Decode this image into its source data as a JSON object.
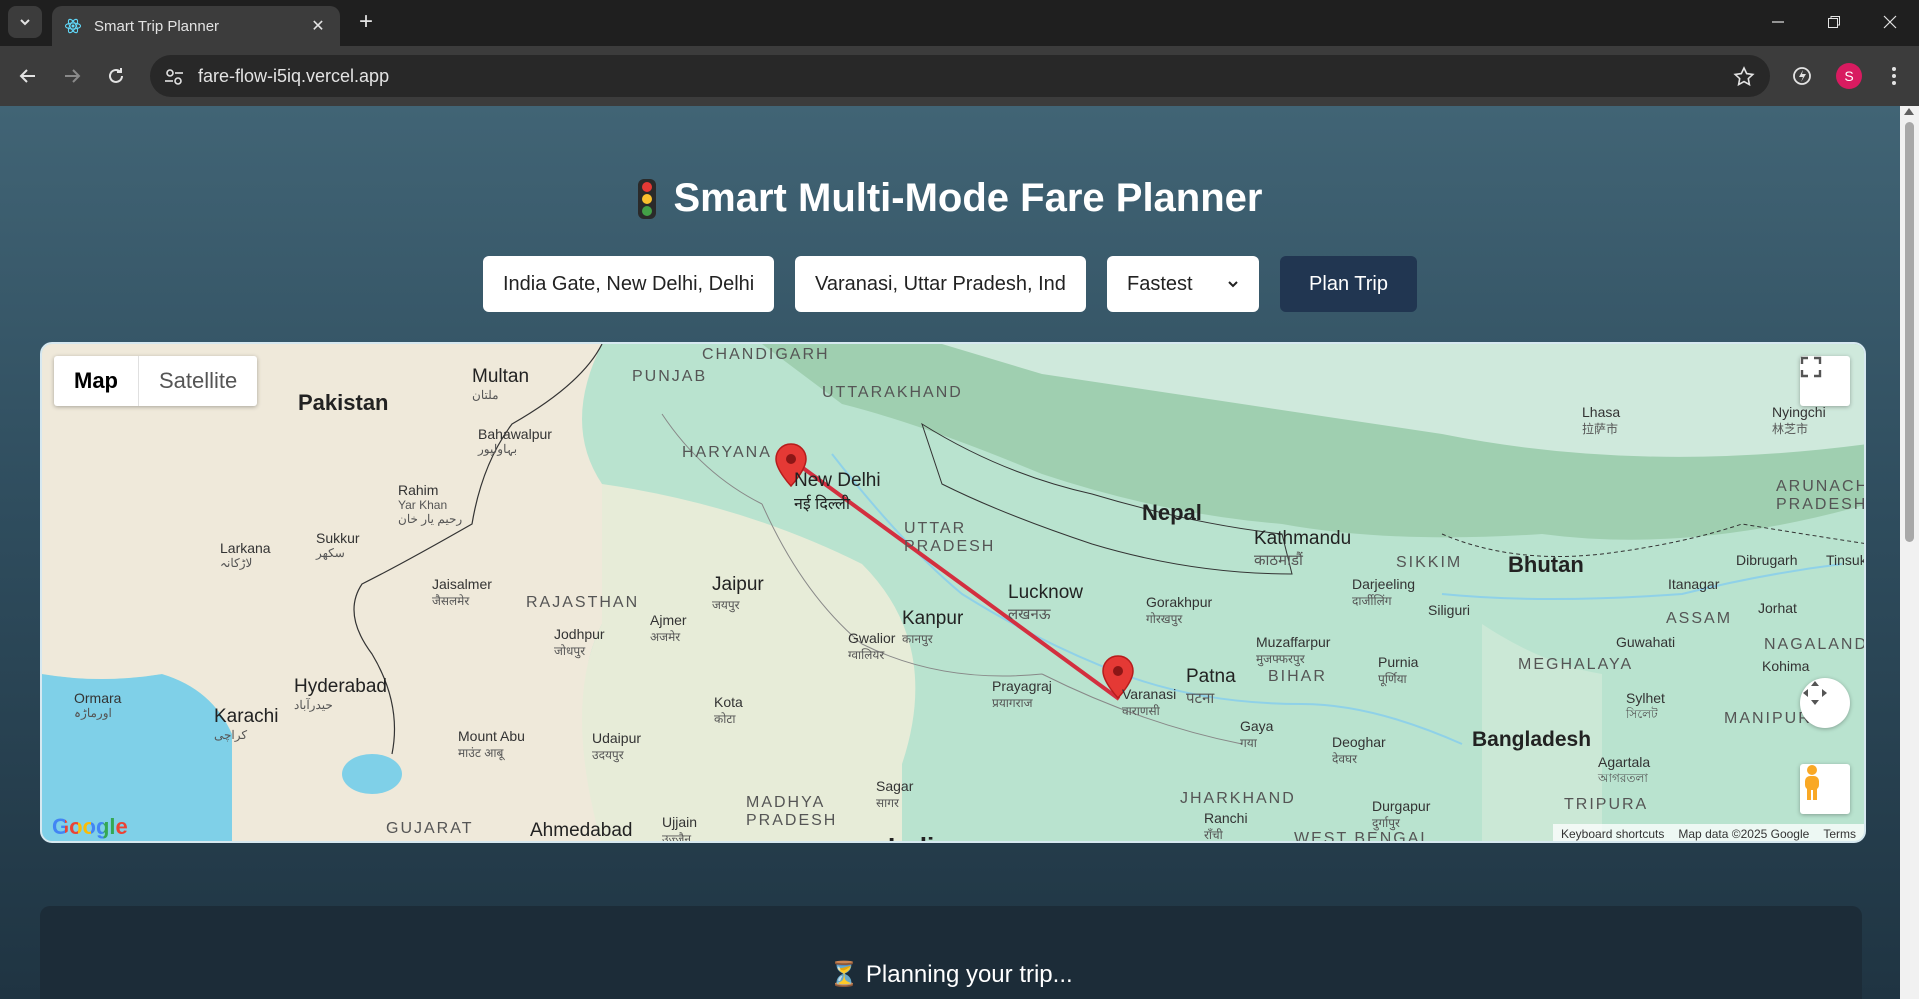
{
  "browser": {
    "tab_title": "Smart Trip Planner",
    "url": "fare-flow-i5iq.vercel.app",
    "profile_initial": "S",
    "new_tab_label": "+",
    "close_label": "✕"
  },
  "page": {
    "title": "Smart Multi-Mode Fare Planner",
    "origin_value": "India Gate, New Delhi, Delhi",
    "destination_value": "Varanasi, Uttar Pradesh, Ind",
    "mode_selected": "Fastest",
    "plan_button": "Plan Trip",
    "status_text": "⏳ Planning your trip..."
  },
  "map": {
    "type_map": "Map",
    "type_satellite": "Satellite",
    "google_logo": "Google",
    "attribution": {
      "shortcuts": "Keyboard shortcuts",
      "data": "Map data ©2025 Google",
      "terms": "Terms"
    },
    "route_color": "#d32f3f",
    "marker_color": "#e53935",
    "labels": {
      "chandigarh": "CHANDIGARH",
      "punjab": "PUNJAB",
      "uttarakhand": "UTTARAKHAND",
      "haryana": "HARYANA",
      "pakistan": "Pakistan",
      "multan": "Multan",
      "multan_ur": "ملتان",
      "bahawalpur": "Bahawalpur",
      "bahawalpur_ur": "بہاولپور",
      "rahim": "Rahim",
      "yar_khan": "Yar Khan",
      "rahim_ur": "رحیم یار خان",
      "sukkur": "Sukkur",
      "sukkur_ur": "سکھر",
      "larkana": "Larkana",
      "larkana_ur": "لاڑکانہ",
      "jaisalmer": "Jaisalmer",
      "jaisalmer_hi": "जैसलमेर",
      "rajasthan": "RAJASTHAN",
      "jaipur": "Jaipur",
      "jaipur_hi": "जयपुर",
      "ajmer": "Ajmer",
      "ajmer_hi": "अजमेर",
      "jodhpur": "Jodhpur",
      "jodhpur_hi": "जोधपुर",
      "hyderabad": "Hyderabad",
      "hyderabad_ur": "حیدرآباد",
      "ormara": "Ormara",
      "ormara_ur": "اورماڑہ",
      "karachi": "Karachi",
      "karachi_ur": "کراچی",
      "mount_abu": "Mount Abu",
      "mount_abu_hi": "माउंट आबू",
      "udaipur": "Udaipur",
      "udaipur_hi": "उदयपुर",
      "kota": "Kota",
      "kota_hi": "कोटा",
      "gujarat": "GUJARAT",
      "ahmedabad": "Ahmedabad",
      "ujjain": "Ujjain",
      "ujjain_hi": "उज्जैन",
      "madhya": "MADHYA",
      "pradesh": "PRADESH",
      "sagar": "Sagar",
      "sagar_hi": "सागर",
      "gwalior": "Gwalior",
      "gwalior_hi": "ग्वालियर",
      "kanpur": "Kanpur",
      "kanpur_hi": "कानपुर",
      "new_delhi": "New Delhi",
      "new_delhi_hi": "नई दिल्ली",
      "uttar": "UTTAR",
      "uttar_pradesh": "PRADESH",
      "lucknow": "Lucknow",
      "lucknow_hi": "लखनऊ",
      "prayagraj": "Prayagraj",
      "prayagraj_hi": "प्रयागराज",
      "varanasi": "Varanasi",
      "varanasi_hi": "वाराणसी",
      "nepal": "Nepal",
      "kathmandu": "Kathmandu",
      "kathmandu_hi": "काठमाडौं",
      "gorakhpur": "Gorakhpur",
      "gorakhpur_hi": "गोरखपुर",
      "muzaffarpur": "Muzaffarpur",
      "muzaffarpur_hi": "मुजफ्फरपुर",
      "bihar": "BIHAR",
      "patna": "Patna",
      "patna_hi": "पटना",
      "gaya": "Gaya",
      "gaya_hi": "गया",
      "deoghar": "Deoghar",
      "deoghar_hi": "देवघर",
      "jharkhand": "JHARKHAND",
      "ranchi": "Ranchi",
      "ranchi_hi": "राँची",
      "west_bengal": "WEST BENGAL",
      "durgapur": "Durgapur",
      "durgapur_hi": "दुर्गापुर",
      "sikkim": "SIKKIM",
      "darjeeling": "Darjeeling",
      "darjeeling_hi": "दार्जीलिंग",
      "siliguri": "Siliguri",
      "purnia": "Purnia",
      "purnia_hi": "पूर्णिया",
      "bhutan": "Bhutan",
      "lhasa": "Lhasa",
      "lhasa_zh": "拉萨市",
      "nyingchi": "Nyingchi",
      "nyingchi_zh": "林芝市",
      "arunachal": "ARUNACHAL",
      "arunachal_pradesh": "PRADESH",
      "dibrugarh": "Dibrugarh",
      "tinsukia": "Tinsuk",
      "itanagar": "Itanagar",
      "jorhat": "Jorhat",
      "assam": "ASSAM",
      "guwahati": "Guwahati",
      "nagaland": "NAGALAND",
      "kohima": "Kohima",
      "meghalaya": "MEGHALAYA",
      "sylhet": "Sylhet",
      "sylhet_bn": "সিলেট",
      "manipur": "MANIPUR",
      "bangladesh": "Bangladesh",
      "agartala": "Agartala",
      "agartala_bn": "আগরতলা",
      "tripura": "TRIPURA",
      "india": "India"
    }
  }
}
